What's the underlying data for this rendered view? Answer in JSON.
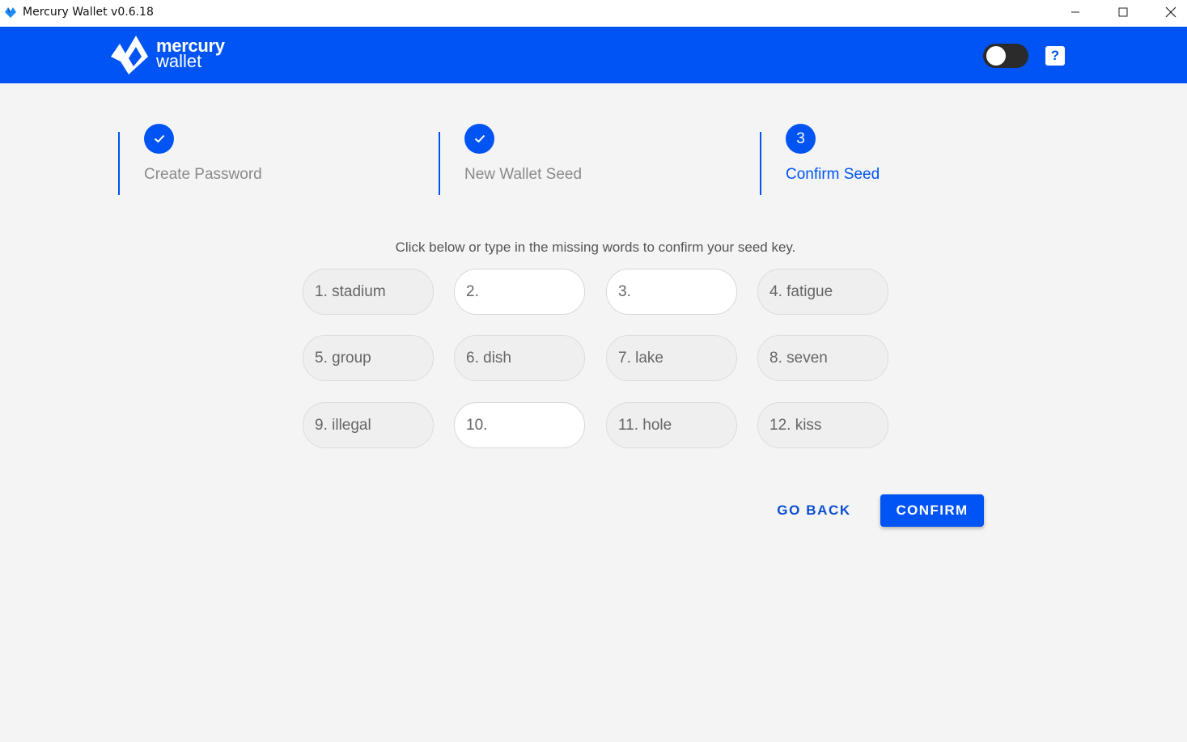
{
  "window": {
    "title": "Mercury Wallet v0.6.18"
  },
  "header": {
    "logo_line1": "mercury",
    "logo_line2": "wallet",
    "help_label": "?",
    "toggle_state": "off"
  },
  "steps": [
    {
      "label": "Create Password",
      "state": "complete"
    },
    {
      "label": "New Wallet Seed",
      "state": "complete"
    },
    {
      "number": "3",
      "label": "Confirm Seed",
      "state": "active"
    }
  ],
  "instructions": "Click below or type in the missing words to confirm your seed key.",
  "seed_words": [
    {
      "text": "1. stadium",
      "empty": false
    },
    {
      "text": "2.",
      "empty": true
    },
    {
      "text": "3.",
      "empty": true
    },
    {
      "text": "4. fatigue",
      "empty": false
    },
    {
      "text": "5. group",
      "empty": false
    },
    {
      "text": "6. dish",
      "empty": false
    },
    {
      "text": "7. lake",
      "empty": false
    },
    {
      "text": "8. seven",
      "empty": false
    },
    {
      "text": "9. illegal",
      "empty": false
    },
    {
      "text": "10.",
      "empty": true
    },
    {
      "text": "11. hole",
      "empty": false
    },
    {
      "text": "12. kiss",
      "empty": false
    }
  ],
  "actions": {
    "go_back": "GO BACK",
    "confirm": "CONFIRM"
  },
  "colors": {
    "brand": "#0054f4",
    "background": "#f4f4f4"
  }
}
